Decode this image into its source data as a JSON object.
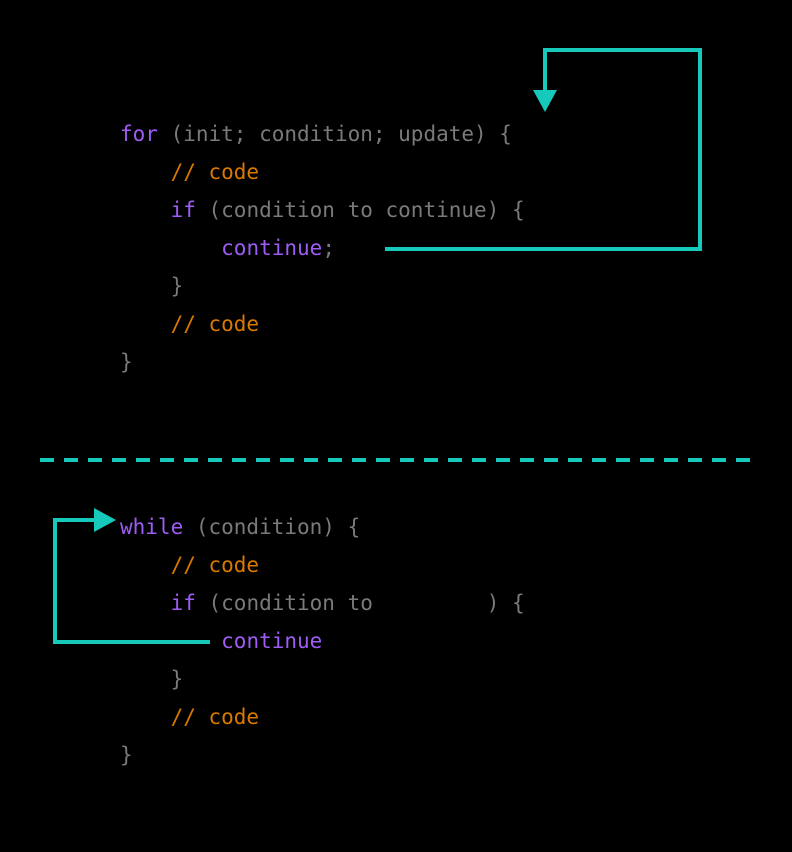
{
  "for_block": {
    "l1": {
      "kw": "for",
      "rest": " (init; condition; update) {"
    },
    "l2": {
      "cm": "// code"
    },
    "l3": {
      "kw": "if",
      "rest": " (condition to continue) {"
    },
    "l4": {
      "kw": "continue",
      "rest": ";"
    },
    "l5": {
      "rest": "}"
    },
    "l6": {
      "cm": "// code"
    },
    "l7": {
      "rest": "}"
    }
  },
  "while_block": {
    "l1": {
      "kw": "while",
      "rest": " (condition) {"
    },
    "l2": {
      "cm": "// code"
    },
    "l3": {
      "kw": "if",
      "rest1": " (condition to ",
      "rest2": ") {"
    },
    "l4": {
      "kw": "continue"
    },
    "l5": {
      "rest": "}"
    },
    "l6": {
      "cm": "// code"
    },
    "l7": {
      "rest": "}"
    }
  }
}
